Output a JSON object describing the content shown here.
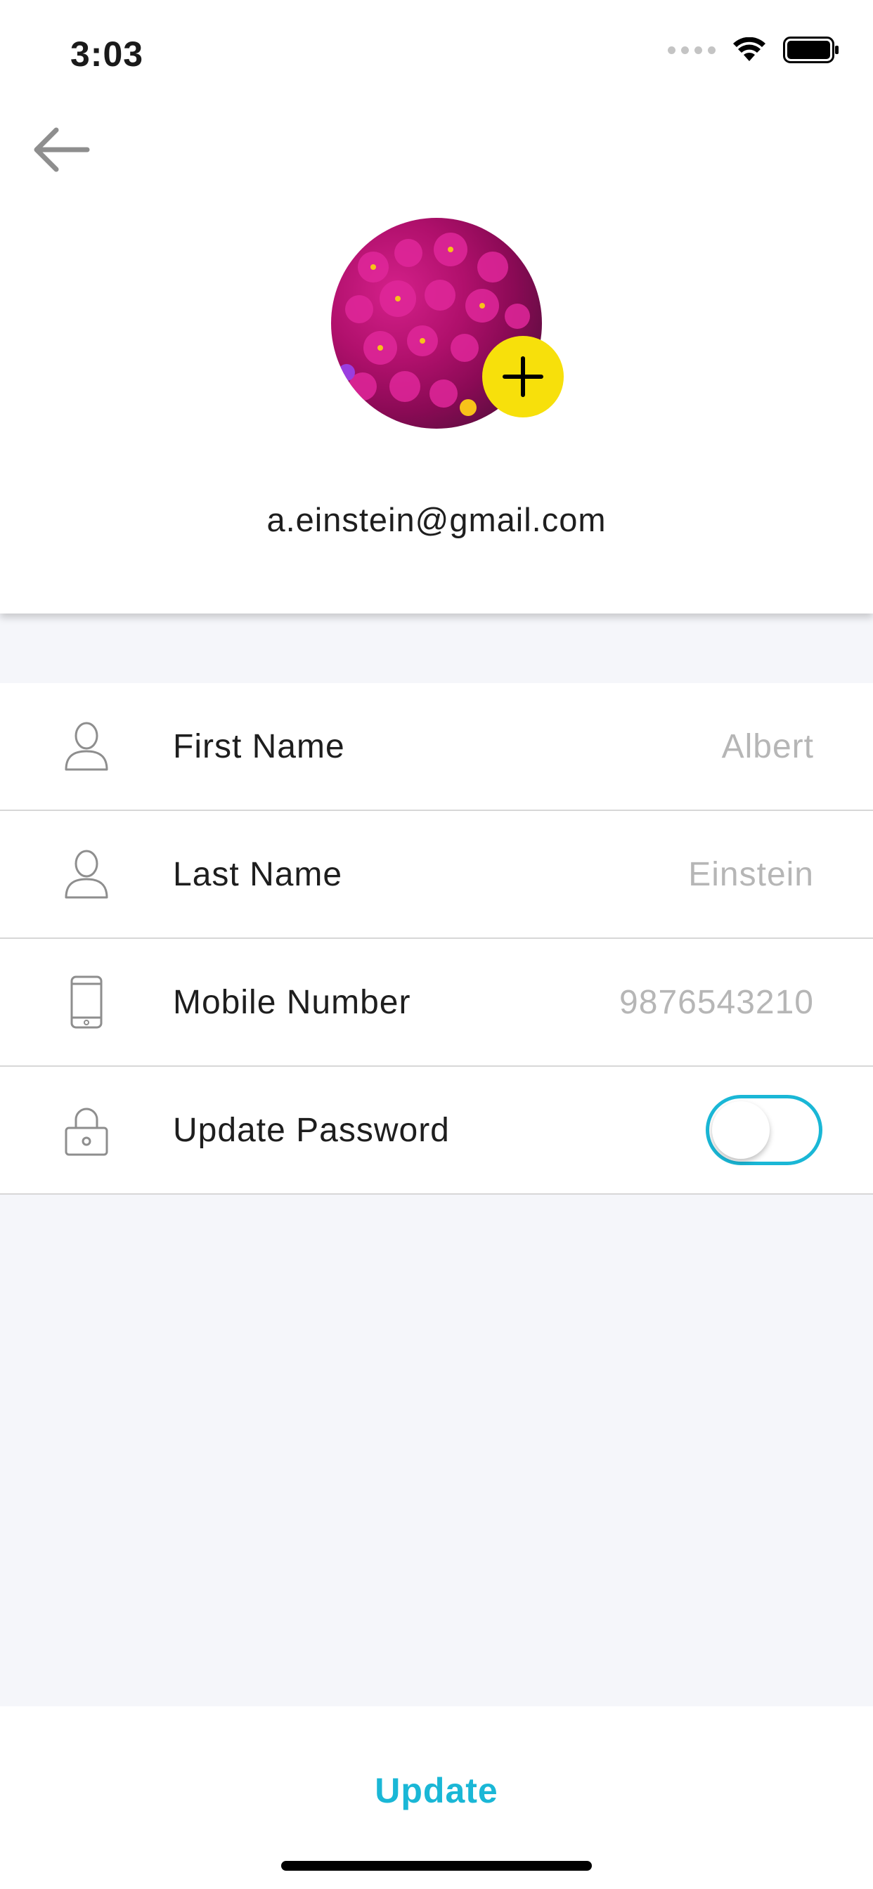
{
  "status_bar": {
    "time": "3:03",
    "icons": [
      "cellular-signal-icon",
      "wifi-icon",
      "battery-icon"
    ]
  },
  "header": {
    "back_icon": "arrow-left-icon",
    "avatar_alt": "profile photo",
    "add_photo_icon": "plus-icon",
    "email": "a.einstein@gmail.com"
  },
  "form": {
    "first_name": {
      "label": "First Name",
      "placeholder": "Albert",
      "icon": "user-icon"
    },
    "last_name": {
      "label": "Last Name",
      "placeholder": "Einstein",
      "icon": "user-icon"
    },
    "mobile": {
      "label": "Mobile Number",
      "placeholder": "9876543210",
      "icon": "mobile-phone-icon"
    },
    "password": {
      "label": "Update Password",
      "icon": "lock-icon",
      "toggle_on": false
    }
  },
  "footer": {
    "update_label": "Update"
  },
  "colors": {
    "accent": "#1ab7d6",
    "add_button": "#f7e00b",
    "background": "#f5f6fa",
    "placeholder": "#b6b6b6"
  }
}
